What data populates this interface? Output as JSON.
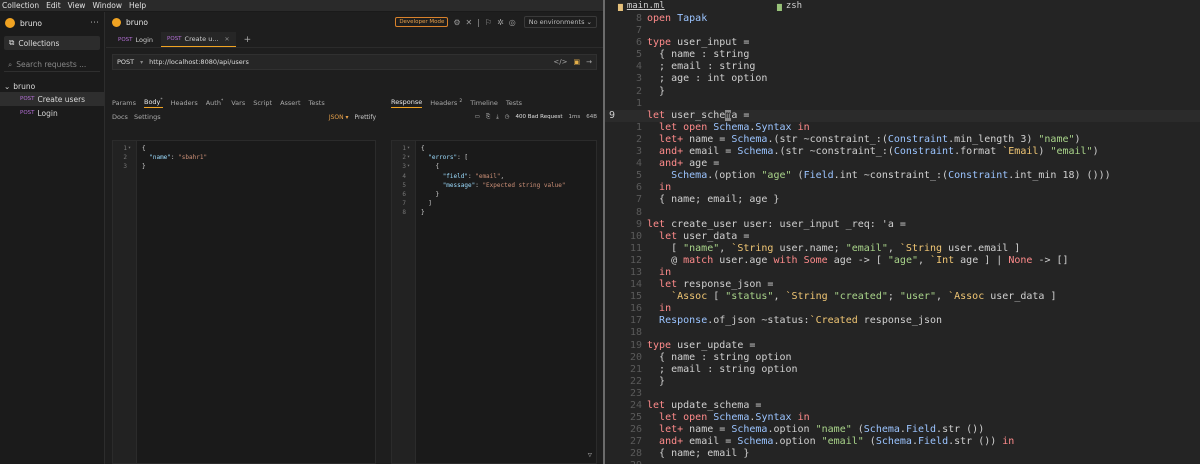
{
  "menu": [
    "Collection",
    "Edit",
    "View",
    "Window",
    "Help"
  ],
  "sidebar": {
    "app_name": "bruno",
    "collections_label": "Collections",
    "search_placeholder": "Search requests ...",
    "collection_name": "bruno",
    "items": [
      {
        "method": "POST",
        "name": "Create users"
      },
      {
        "method": "POST",
        "name": "Login"
      }
    ]
  },
  "topbar": {
    "collection": "bruno",
    "dev_mode": "Developer Mode",
    "environment": "No environments"
  },
  "tabs": [
    {
      "method": "POST",
      "name": "Login"
    },
    {
      "method": "POST",
      "name": "Create u..."
    }
  ],
  "request": {
    "method": "POST",
    "url": "http://localhost:8080/api/users",
    "tabs": [
      "Params",
      "Body",
      "Headers",
      "Auth",
      "Vars",
      "Script",
      "Assert",
      "Tests"
    ],
    "body_marker": "*",
    "auth_marker": "*",
    "subtabs": [
      "Docs",
      "Settings"
    ],
    "body_type": "JSON",
    "prettify": "Prettify",
    "body_lines": [
      {
        "n": "1",
        "fold": "▾",
        "text": "{"
      },
      {
        "n": "2",
        "fold": "",
        "key": "\"name\"",
        "sep": ": ",
        "val": "\"sbahr1\"",
        "indent": "  "
      },
      {
        "n": "3",
        "fold": "",
        "text": "}"
      }
    ]
  },
  "response": {
    "tabs": [
      "Response",
      "Headers",
      "Timeline",
      "Tests"
    ],
    "headers_count": "2",
    "status": "400 Bad Request",
    "time": "1ms",
    "size": "64B",
    "lines": [
      {
        "n": "1",
        "fold": "▾",
        "text": "{"
      },
      {
        "n": "2",
        "fold": "▾",
        "indent": "  ",
        "key": "\"errors\"",
        "sep": ": ",
        "rest": "["
      },
      {
        "n": "3",
        "fold": "▾",
        "indent": "    ",
        "text": "{"
      },
      {
        "n": "4",
        "fold": "",
        "indent": "      ",
        "key": "\"field\"",
        "sep": ": ",
        "val": "\"email\"",
        "rest": ","
      },
      {
        "n": "5",
        "fold": "",
        "indent": "      ",
        "key": "\"message\"",
        "sep": ": ",
        "val": "\"Expected string value\""
      },
      {
        "n": "6",
        "fold": "",
        "indent": "    ",
        "text": "}"
      },
      {
        "n": "7",
        "fold": "",
        "indent": "  ",
        "text": "]"
      },
      {
        "n": "8",
        "fold": "",
        "text": "}"
      }
    ]
  },
  "terminal": {
    "tabs": [
      {
        "label": "main.ml",
        "active": true
      },
      {
        "label": "zsh",
        "active": false
      }
    ],
    "current_line": "9",
    "lines": [
      {
        "n": "8",
        "c": "open Tapak"
      },
      {
        "n": "7",
        "c": ""
      },
      {
        "n": "6",
        "c": "type user_input ="
      },
      {
        "n": "5",
        "c": "  { name : string"
      },
      {
        "n": "4",
        "c": "  ; email : string"
      },
      {
        "n": "3",
        "c": "  ; age : int option"
      },
      {
        "n": "2",
        "c": "  }"
      },
      {
        "n": "1",
        "c": ""
      },
      {
        "n": "9",
        "c": "let user_schema =",
        "cur": true
      },
      {
        "n": "1",
        "c": "  let open Schema.Syntax in"
      },
      {
        "n": "2",
        "c": "  let+ name = Schema.(str ~constraint_:(Constraint.min_length 3) \"name\")"
      },
      {
        "n": "3",
        "c": "  and+ email = Schema.(str ~constraint_:(Constraint.format `Email) \"email\")"
      },
      {
        "n": "4",
        "c": "  and+ age ="
      },
      {
        "n": "5",
        "c": "    Schema.(option \"age\" (Field.int ~constraint_:(Constraint.int_min 18) ()))"
      },
      {
        "n": "6",
        "c": "  in"
      },
      {
        "n": "7",
        "c": "  { name; email; age }"
      },
      {
        "n": "8",
        "c": ""
      },
      {
        "n": "9",
        "c": "let create_user user: user_input _req: 'a ="
      },
      {
        "n": "10",
        "c": "  let user_data ="
      },
      {
        "n": "11",
        "c": "    [ \"name\", `String user.name; \"email\", `String user.email ]"
      },
      {
        "n": "12",
        "c": "    @ match user.age with Some age -> [ \"age\", `Int age ] | None -> []"
      },
      {
        "n": "13",
        "c": "  in"
      },
      {
        "n": "14",
        "c": "  let response_json ="
      },
      {
        "n": "15",
        "c": "    `Assoc [ \"status\", `String \"created\"; \"user\", `Assoc user_data ]"
      },
      {
        "n": "16",
        "c": "  in"
      },
      {
        "n": "17",
        "c": "  Response.of_json ~status:`Created response_json"
      },
      {
        "n": "18",
        "c": ""
      },
      {
        "n": "19",
        "c": "type user_update ="
      },
      {
        "n": "20",
        "c": "  { name : string option"
      },
      {
        "n": "21",
        "c": "  ; email : string option"
      },
      {
        "n": "22",
        "c": "  }"
      },
      {
        "n": "23",
        "c": ""
      },
      {
        "n": "24",
        "c": "let update_schema ="
      },
      {
        "n": "25",
        "c": "  let open Schema.Syntax in"
      },
      {
        "n": "26",
        "c": "  let+ name = Schema.option \"name\" (Schema.Field.str ())"
      },
      {
        "n": "27",
        "c": "  and+ email = Schema.option \"email\" (Schema.Field.str ()) in"
      },
      {
        "n": "28",
        "c": "  { name; email }"
      },
      {
        "n": "29",
        "c": ""
      }
    ]
  }
}
